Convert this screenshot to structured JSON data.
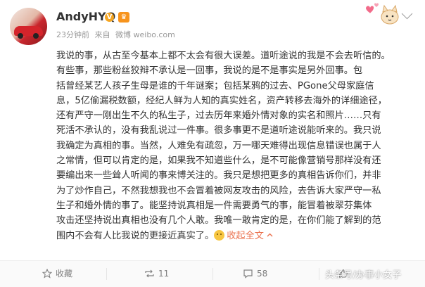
{
  "user": {
    "name": "AndyHYQ",
    "verified_icon": "v-badge-icon",
    "member_icon": "crown-badge-icon"
  },
  "meta": {
    "time": "23分钟前",
    "source_prefix": "来自",
    "source": "微博 weibo.com"
  },
  "post": {
    "lines": [
      "我说的事，从古至今基本上都不太会有很大误差。道听途说的我是不会去听信的。",
      "有些事，那些粉丝狡辩不承认是一回事，我说的是不是事实是另外回事。包",
      "括曾经某艺人孩子生母是谁的千年谜案；包括某鸦的过去、PGone父母家庭信",
      "息，5亿偷漏税数额，经纪人鲜为人知的真实姓名，资产转移去海外的详细途径，",
      "还有严守一刚出生不久的私生子，过去历年来婚外情对象的实名和照片……只有",
      "死活不承认的，没有我乱说过一件事。很多事更不是道听途说能听来的。我只说",
      "我确定为真相的事。当然，人难免有疏忽，万一哪天难得出现信息错误也属于人",
      "之常情，但可以肯定的是，如果我不知道些什么，是不可能像营销号那样没有还",
      "要编出来一些耸人听闻的事来博关注的。我只是想把更多的真相告诉你们，并非",
      "为了炒作自己，不然我想我也不会冒着被网友攻击的风险，去告诉大家严守一私",
      "生子和婚外情的事了。能坚持说真相是一件需要勇气的事，能冒着被翠芬集体",
      "攻击还坚持说出真相也没有几个人敢。我唯一敢肯定的是，在你们能了解到的范",
      "围内不会有人比我说的更接近真实了。"
    ],
    "collapse_label": "收起全文",
    "collapse_icon": "chevron-up-icon",
    "emoji_icon": "smile-emoji-icon"
  },
  "toolbar": {
    "favorite": {
      "label": "收藏",
      "icon": "star-icon"
    },
    "repost": {
      "label": "11",
      "icon": "repost-icon"
    },
    "comment": {
      "label": "58",
      "icon": "comment-icon"
    },
    "like": {
      "label": "",
      "icon": "thumbs-up-icon"
    }
  },
  "watermark": "头条号/办事小女子",
  "colors": {
    "link": "#eb7350",
    "text": "#333333",
    "meta": "#999999",
    "badge": "#f5a623"
  }
}
